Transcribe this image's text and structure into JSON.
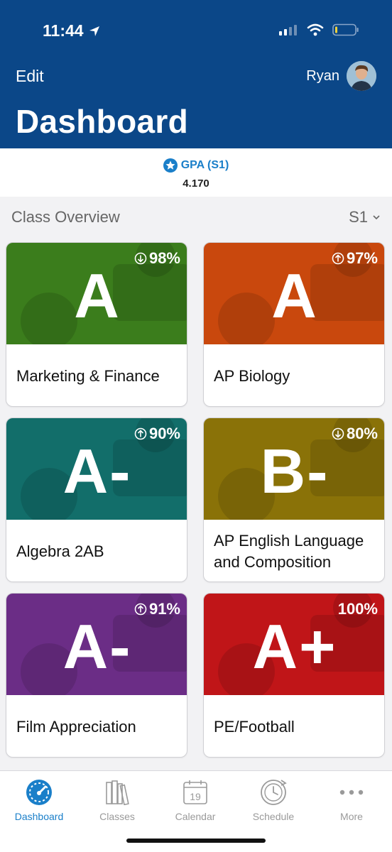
{
  "status": {
    "time": "11:44"
  },
  "header": {
    "edit_label": "Edit",
    "user_name": "Ryan",
    "title": "Dashboard"
  },
  "gpa": {
    "label": "GPA (S1)",
    "value": "4.170"
  },
  "overview": {
    "title": "Class Overview",
    "semester": "S1"
  },
  "classes": [
    {
      "name": "Marketing & Finance",
      "grade": "A",
      "percent": "98%",
      "trend": "down",
      "color": "#3b7d1c"
    },
    {
      "name": "AP Biology",
      "grade": "A",
      "percent": "97%",
      "trend": "up",
      "color": "#c9480d"
    },
    {
      "name": "Algebra 2AB",
      "grade": "A-",
      "percent": "90%",
      "trend": "up",
      "color": "#126e6a"
    },
    {
      "name": "AP English Language and Composition",
      "grade": "B-",
      "percent": "80%",
      "trend": "down",
      "color": "#8a7208"
    },
    {
      "name": "Film Appreciation",
      "grade": "A-",
      "percent": "91%",
      "trend": "up",
      "color": "#6b2d86"
    },
    {
      "name": "PE/Football",
      "grade": "A+",
      "percent": "100%",
      "trend": "none",
      "color": "#c01518"
    }
  ],
  "tabs": [
    {
      "label": "Dashboard",
      "icon": "speedometer-icon",
      "active": true
    },
    {
      "label": "Classes",
      "icon": "books-icon",
      "active": false
    },
    {
      "label": "Calendar",
      "icon": "calendar-icon",
      "active": false,
      "day": "19"
    },
    {
      "label": "Schedule",
      "icon": "clock-icon",
      "active": false
    },
    {
      "label": "More",
      "icon": "more-icon",
      "active": false
    }
  ],
  "colors": {
    "header": "#0b4788",
    "accent": "#1a7fc9"
  }
}
